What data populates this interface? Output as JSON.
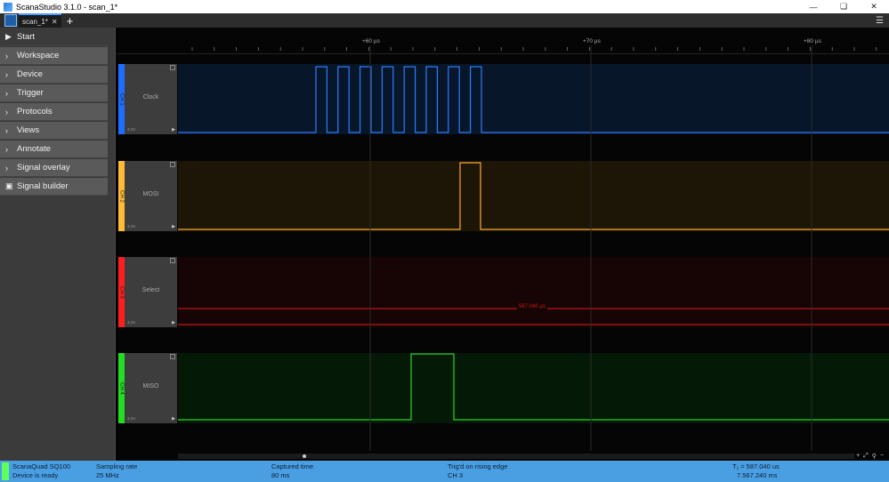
{
  "window": {
    "title": "ScanaStudio 3.1.0 - scan_1*"
  },
  "tabs": [
    {
      "label": "scan_1*"
    }
  ],
  "sidebar": {
    "start_label": "Start",
    "items": [
      {
        "label": "Workspace",
        "icon": "chevron-right-icon"
      },
      {
        "label": "Device",
        "icon": "chevron-right-icon"
      },
      {
        "label": "Trigger",
        "icon": "chevron-right-icon"
      },
      {
        "label": "Protocols",
        "icon": "chevron-right-icon"
      },
      {
        "label": "Views",
        "icon": "chevron-right-icon"
      },
      {
        "label": "Annotate",
        "icon": "chevron-right-icon"
      },
      {
        "label": "Signal overlay",
        "icon": "chevron-right-icon"
      },
      {
        "label": "Signal builder",
        "icon": "lock-icon"
      }
    ]
  },
  "ruler": {
    "labels": [
      "+60 µs",
      "+70 µs",
      "+80 µs"
    ]
  },
  "channels": [
    {
      "id": "CH 1",
      "name": "Clock",
      "color": "#1e6fff",
      "bg": "#071629",
      "voltage": "3.3V",
      "wave_color": "#2d7cff"
    },
    {
      "id": "CH 2",
      "name": "MOSI",
      "color": "#ffbb33",
      "bg": "#1d1606",
      "voltage": "3.3V",
      "wave_color": "#ffaa2b"
    },
    {
      "id": "CH 3",
      "name": "Select",
      "color": "#ff1f1f",
      "bg": "#170404",
      "voltage": "3.3V",
      "wave_color": "#e01b1b",
      "marker": "587.040 µs"
    },
    {
      "id": "CH 4",
      "name": "MISO",
      "color": "#22dd22",
      "bg": "#051a06",
      "voltage": "3.3V",
      "wave_color": "#28d428"
    }
  ],
  "status": {
    "device_name": "ScanaQuad SQ100",
    "device_state": "Device is ready",
    "sampling_label": "Sampling rate",
    "sampling_value": "25 MHz",
    "captured_label": "Captured time",
    "captured_value": "80 ms",
    "trigger_label": "Trig'd on rising edge",
    "trigger_value": "CH 3",
    "t1_label": "T₁ = 587.040 us",
    "t1_value": "7.567 240 ms",
    "accent": "#4a9fe2"
  }
}
